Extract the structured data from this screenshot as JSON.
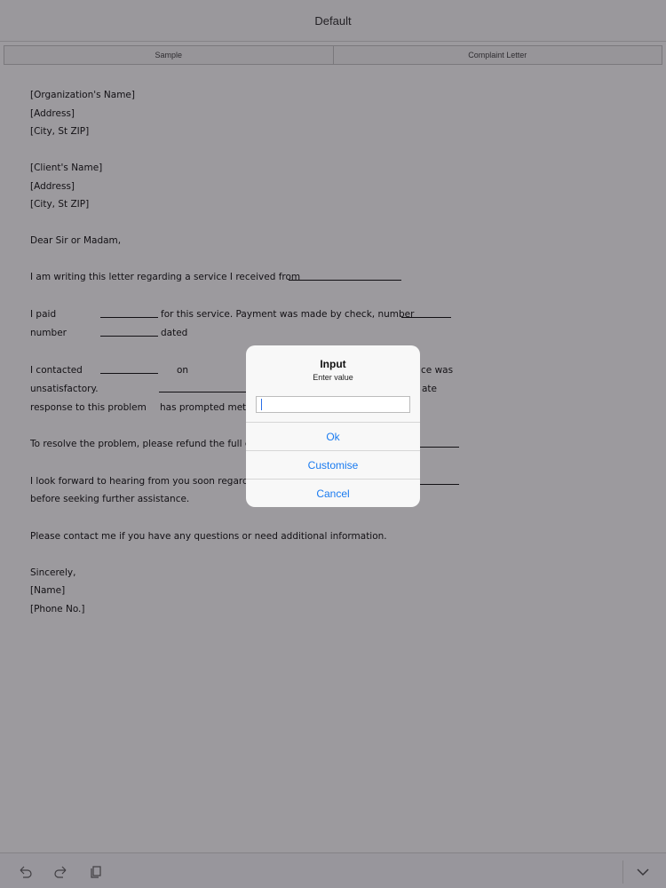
{
  "nav": {
    "title": "Default"
  },
  "segments": [
    {
      "label": "Sample"
    },
    {
      "label": "Complaint Letter"
    }
  ],
  "letter": {
    "org_name": "[Organization's Name]",
    "org_address": "[Address]",
    "org_city": "[City, St ZIP]",
    "client_name": "[Client's Name]",
    "client_address": "[Address]",
    "client_city": "[City, St ZIP]",
    "salutation": "Dear Sir or Madam,",
    "p1": "I am writing this letter regarding a service I received from",
    "p2a": "I paid",
    "p2b": "for this service. Payment was made by check, number",
    "p2c": "number",
    "p2d": "dated",
    "p3a": "I contacted",
    "p3b": "on",
    "p3c": "ce was",
    "p3d": "unsatisfactory.",
    "p3e": "ate",
    "p3f": "response to this problem",
    "p3g": "has prompted me",
    "p3h": "t",
    "p4": "To resolve the problem, please refund the full co",
    "p5a": "I look forward to hearing from you soon regarding",
    "p5b": "before seeking further assistance.",
    "p6": "Please contact me if you have any questions or need additional information.",
    "closing": "Sincerely,",
    "name": "[Name]",
    "phone": "[Phone No.]"
  },
  "dialog": {
    "title": "Input",
    "message": "Enter value",
    "input_value": "",
    "input_placeholder": "",
    "ok_label": "Ok",
    "customise_label": "Customise",
    "cancel_label": "Cancel"
  },
  "toolbar": {
    "icons": [
      "undo-icon",
      "redo-icon",
      "copy-icon",
      "chevron-down-icon"
    ]
  },
  "colors": {
    "dialog_button": "#1a7bf0",
    "overlay": "#979599"
  }
}
